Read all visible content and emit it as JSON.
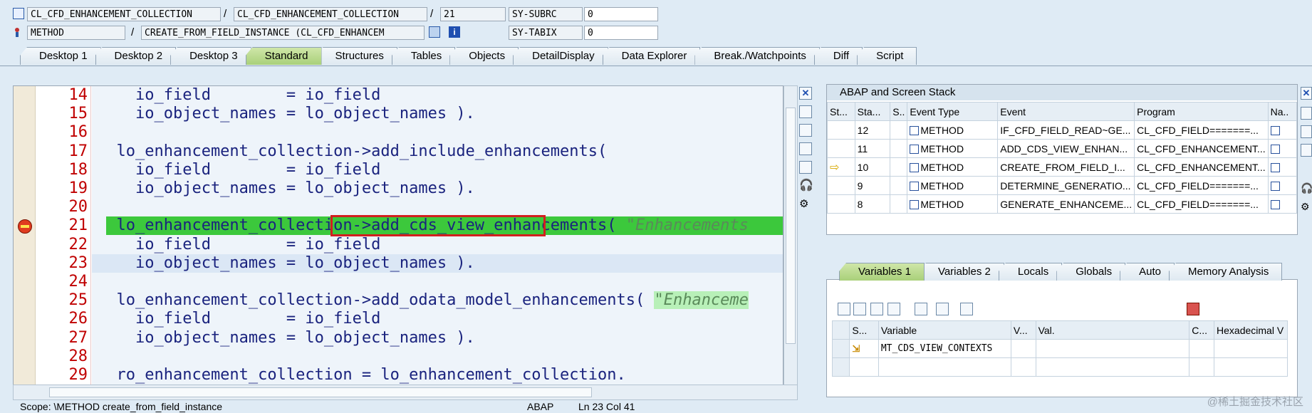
{
  "header": {
    "row1": {
      "class_field": "CL_CFD_ENHANCEMENT_COLLECTION",
      "include_field": "CL_CFD_ENHANCEMENT_COLLECTION",
      "line_field": "21",
      "var_label": "SY-SUBRC",
      "var_value": "0"
    },
    "row2": {
      "type_field": "METHOD",
      "method_field": "CREATE_FROM_FIELD_INSTANCE (CL_CFD_ENHANCEM",
      "var_label": "SY-TABIX",
      "var_value": "0"
    },
    "separator": "/"
  },
  "tabs": [
    {
      "label": "Desktop 1"
    },
    {
      "label": "Desktop 2"
    },
    {
      "label": "Desktop 3"
    },
    {
      "label": "Standard",
      "active": true
    },
    {
      "label": "Structures"
    },
    {
      "label": "Tables"
    },
    {
      "label": "Objects"
    },
    {
      "label": "DetailDisplay"
    },
    {
      "label": "Data Explorer"
    },
    {
      "label": "Break./Watchpoints"
    },
    {
      "label": "Diff"
    },
    {
      "label": "Script"
    }
  ],
  "code": {
    "lines": [
      {
        "no": "14",
        "text": "    io_field        = io_field"
      },
      {
        "no": "15",
        "text": "    io_object_names = lo_object_names )."
      },
      {
        "no": "16",
        "text": ""
      },
      {
        "no": "17",
        "text": "  lo_enhancement_collection->add_include_enhancements("
      },
      {
        "no": "18",
        "text": "    io_field        = io_field"
      },
      {
        "no": "19",
        "text": "    io_object_names = lo_object_names )."
      },
      {
        "no": "20",
        "text": ""
      },
      {
        "no": "21",
        "text": "  lo_enhancement_collection->add_cds_view_enhancements( ",
        "comment": "\"Enhancements"
      },
      {
        "no": "22",
        "text": "    io_field        = io_field"
      },
      {
        "no": "23",
        "text": "    io_object_names = lo_object_names )."
      },
      {
        "no": "24",
        "text": ""
      },
      {
        "no": "25",
        "text": "  lo_enhancement_collection->add_odata_model_enhancements( ",
        "comment": "\"Enhanceme"
      },
      {
        "no": "26",
        "text": "    io_field        = io_field"
      },
      {
        "no": "27",
        "text": "    io_object_names = lo_object_names )."
      },
      {
        "no": "28",
        "text": ""
      },
      {
        "no": "29",
        "text": "  ro_enhancement_collection = lo_enhancement_collection."
      }
    ]
  },
  "stack": {
    "title": "ABAP and Screen Stack",
    "columns": [
      "St...",
      "Sta...",
      "S..",
      "Event Type",
      "Event",
      "Program",
      "Na.."
    ],
    "rows": [
      {
        "level": "12",
        "type": "METHOD",
        "event": "IF_CFD_FIELD_READ~GE...",
        "program": "CL_CFD_FIELD=======..."
      },
      {
        "level": "11",
        "type": "METHOD",
        "event": "ADD_CDS_VIEW_ENHAN...",
        "program": "CL_CFD_ENHANCEMENT..."
      },
      {
        "level": "10",
        "type": "METHOD",
        "event": "CREATE_FROM_FIELD_I...",
        "program": "CL_CFD_ENHANCEMENT..."
      },
      {
        "level": "9",
        "type": "METHOD",
        "event": "DETERMINE_GENERATIO...",
        "program": "CL_CFD_FIELD=======..."
      },
      {
        "level": "8",
        "type": "METHOD",
        "event": "GENERATE_ENHANCEME...",
        "program": "CL_CFD_FIELD=======..."
      }
    ]
  },
  "vartabs": [
    {
      "label": "Variables 1",
      "active": true
    },
    {
      "label": "Variables 2"
    },
    {
      "label": "Locals"
    },
    {
      "label": "Globals"
    },
    {
      "label": "Auto"
    },
    {
      "label": "Memory Analysis"
    }
  ],
  "variables": {
    "columns": [
      "S...",
      "Variable",
      "V...",
      "Val.",
      "C...",
      "Hexadecimal V"
    ],
    "rows": [
      {
        "variable": "MT_CDS_VIEW_CONTEXTS"
      }
    ]
  },
  "status": {
    "scope": "Scope: \\METHOD create_from_field_instance",
    "lang": "ABAP",
    "pos": "Ln 23 Col 41"
  },
  "watermark": "@稀土掘金技术社区"
}
